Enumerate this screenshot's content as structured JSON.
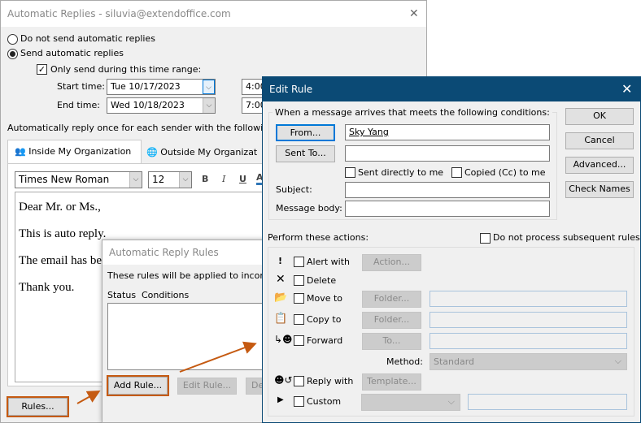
{
  "main": {
    "title": "Automatic Replies - siluvia@extendoffice.com",
    "close": "✕",
    "radio_off": "Do not send automatic replies",
    "radio_on": "Send automatic replies",
    "time_range": "Only send during this time range:",
    "start_label": "Start time:",
    "start_date": "Tue 10/17/2023",
    "start_time": "4:00",
    "end_label": "End time:",
    "end_date": "Wed 10/18/2023",
    "end_time": "7:00",
    "reply_once": "Automatically reply once for each sender with the following m",
    "tab_inside": "Inside My Organization",
    "tab_outside": "Outside My Organizat",
    "font": "Times New Roman",
    "size": "12",
    "bold": "B",
    "italic": "I",
    "underline": "U",
    "color": "A",
    "body": [
      "Dear Mr. or Ms.,",
      "This is auto reply.",
      "The email has bee",
      "Thank you."
    ],
    "rules_button": "Rules..."
  },
  "rules": {
    "title": "Automatic Reply Rules",
    "desc": "These rules will be applied to incomin",
    "col_status": "Status",
    "col_conditions": "Conditions",
    "add": "Add Rule...",
    "edit": "Edit Rule...",
    "delete": "De"
  },
  "edit": {
    "title": "Edit Rule",
    "close": "✕",
    "conditions_legend": "When a message arrives that meets the following conditions:",
    "from": "From...",
    "from_value": "Sky Yang",
    "sent_to": "Sent To...",
    "sent_directly": "Sent directly to me",
    "copied": "Copied (Cc) to me",
    "subject": "Subject:",
    "message_body": "Message body:",
    "ok": "OK",
    "cancel": "Cancel",
    "advanced": "Advanced...",
    "check_names": "Check Names",
    "perform": "Perform these actions:",
    "do_not_process": "Do not process subsequent rules",
    "actions": [
      {
        "label": "Alert with",
        "button": "Action..."
      },
      {
        "label": "Delete"
      },
      {
        "label": "Move to",
        "button": "Folder..."
      },
      {
        "label": "Copy to",
        "button": "Folder..."
      },
      {
        "label": "Forward",
        "button": "To..."
      },
      {
        "label": "Reply with",
        "button": "Template..."
      },
      {
        "label": "Custom"
      }
    ],
    "method_label": "Method:",
    "method_value": "Standard"
  },
  "colors": {
    "accent_highlight": "#c55a11",
    "titlebar": "#0b4a75"
  }
}
